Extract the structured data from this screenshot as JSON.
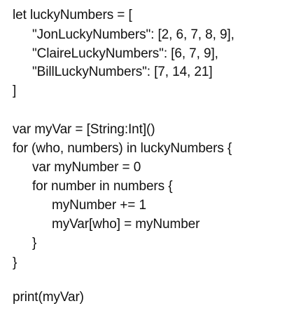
{
  "code": {
    "lines": [
      "let luckyNumbers = [",
      "\"JonLuckyNumbers\": [2, 6, 7, 8, 9],",
      "\"ClaireLuckyNumbers\": [6, 7, 9],",
      "\"BillLuckyNumbers\": [7, 14, 21]",
      "]",
      "var myVar = [String:Int]()",
      "for (who, numbers) in luckyNumbers {",
      "var myNumber = 0",
      "for number in numbers {",
      "myNumber += 1",
      "myVar[who] = myNumber",
      "}",
      "}",
      "print(myVar)"
    ]
  }
}
